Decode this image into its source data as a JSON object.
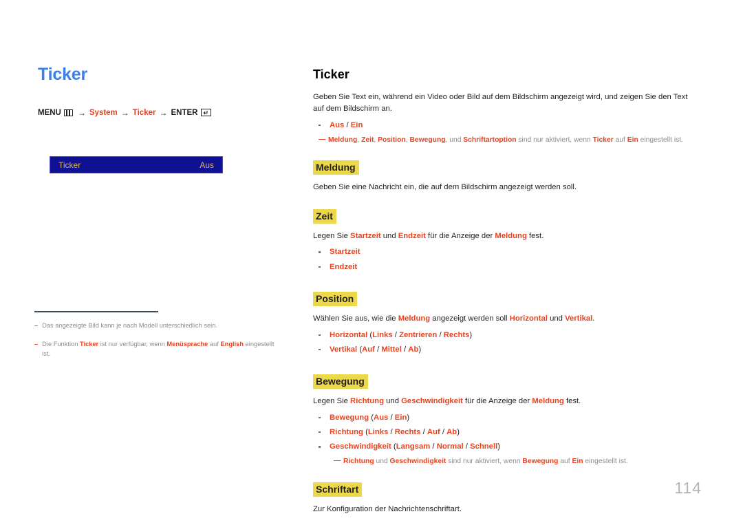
{
  "left": {
    "title": "Ticker",
    "menu_path": {
      "menu_label": "MENU",
      "menu_icon": "menu-grid-icon",
      "arrow": "→",
      "step1": "System",
      "step2": "Ticker",
      "enter_label": "ENTER",
      "enter_icon": "enter-key-icon",
      "enter_glyph": "↵"
    },
    "osd": {
      "label": "Ticker",
      "value": "Aus",
      "bg_color": "#101093",
      "text_color": "#e3b93c"
    },
    "footnotes": [
      {
        "dash": "–",
        "parts": [
          {
            "t": "Das angezeigte Bild kann je nach Modell unterschiedlich sein.",
            "b": false
          }
        ]
      },
      {
        "dash": "–",
        "parts": [
          {
            "t": "Die Funktion ",
            "b": false
          },
          {
            "t": "Ticker",
            "b": true
          },
          {
            "t": " ist nur verfügbar, wenn ",
            "b": false
          },
          {
            "t": "Menüsprache",
            "b": true
          },
          {
            "t": " auf ",
            "b": false
          },
          {
            "t": "English",
            "b": true
          },
          {
            "t": " eingestellt ist.",
            "b": false
          }
        ]
      }
    ]
  },
  "right": {
    "title": "Ticker",
    "intro": [
      {
        "t": "Geben Sie Text ein, während ein Video oder Bild auf dem Bildschirm angezeigt wird, und zeigen Sie den Text auf dem Bildschirm an.",
        "b": false
      }
    ],
    "intro_bullets": [
      [
        {
          "t": "Aus",
          "b": true
        },
        {
          "t": " / ",
          "b": false
        },
        {
          "t": "Ein",
          "b": true
        }
      ]
    ],
    "intro_note": {
      "dash": "—",
      "parts": [
        {
          "t": "Meldung",
          "b": true
        },
        {
          "t": ", ",
          "b": false
        },
        {
          "t": "Zeit",
          "b": true
        },
        {
          "t": ", ",
          "b": false
        },
        {
          "t": "Position",
          "b": true
        },
        {
          "t": ", ",
          "b": false
        },
        {
          "t": "Bewegung",
          "b": true
        },
        {
          "t": ", und ",
          "b": false
        },
        {
          "t": "Schriftartoption",
          "b": true
        },
        {
          "t": " sind nur aktiviert, wenn ",
          "b": false
        },
        {
          "t": "Ticker",
          "b": true
        },
        {
          "t": " auf ",
          "b": false
        },
        {
          "t": "Ein",
          "b": true
        },
        {
          "t": " eingestellt ist.",
          "b": false
        }
      ]
    },
    "sections": [
      {
        "heading": "Meldung",
        "paragraph": [
          {
            "t": "Geben Sie eine Nachricht ein, die auf dem Bildschirm angezeigt werden soll.",
            "b": false
          }
        ],
        "bullets": [],
        "note": null
      },
      {
        "heading": "Zeit",
        "paragraph": [
          {
            "t": "Legen Sie ",
            "b": false
          },
          {
            "t": "Startzeit",
            "b": true
          },
          {
            "t": " und ",
            "b": false
          },
          {
            "t": "Endzeit",
            "b": true
          },
          {
            "t": " für die Anzeige der ",
            "b": false
          },
          {
            "t": "Meldung",
            "b": true
          },
          {
            "t": " fest.",
            "b": false
          }
        ],
        "bullets": [
          [
            {
              "t": "Startzeit",
              "b": true
            }
          ],
          [
            {
              "t": "Endzeit",
              "b": true
            }
          ]
        ],
        "note": null
      },
      {
        "heading": "Position",
        "paragraph": [
          {
            "t": "Wählen Sie aus, wie die ",
            "b": false
          },
          {
            "t": "Meldung",
            "b": true
          },
          {
            "t": " angezeigt werden soll ",
            "b": false
          },
          {
            "t": "Horizontal",
            "b": true
          },
          {
            "t": " und ",
            "b": false
          },
          {
            "t": "Vertikal",
            "b": true
          },
          {
            "t": ".",
            "b": false
          }
        ],
        "bullets": [
          [
            {
              "t": "Horizontal",
              "b": true
            },
            {
              "t": " (",
              "b": false
            },
            {
              "t": "Links",
              "b": true
            },
            {
              "t": " / ",
              "b": false
            },
            {
              "t": "Zentrieren",
              "b": true
            },
            {
              "t": " / ",
              "b": false
            },
            {
              "t": "Rechts",
              "b": true
            },
            {
              "t": ")",
              "b": false
            }
          ],
          [
            {
              "t": "Vertikal",
              "b": true
            },
            {
              "t": " (",
              "b": false
            },
            {
              "t": "Auf",
              "b": true
            },
            {
              "t": " / ",
              "b": false
            },
            {
              "t": "Mittel",
              "b": true
            },
            {
              "t": " / ",
              "b": false
            },
            {
              "t": "Ab",
              "b": true
            },
            {
              "t": ")",
              "b": false
            }
          ]
        ],
        "note": null
      },
      {
        "heading": "Bewegung",
        "paragraph": [
          {
            "t": "Legen Sie ",
            "b": false
          },
          {
            "t": "Richtung",
            "b": true
          },
          {
            "t": " und ",
            "b": false
          },
          {
            "t": "Geschwindigkeit",
            "b": true
          },
          {
            "t": " für die Anzeige der ",
            "b": false
          },
          {
            "t": "Meldung",
            "b": true
          },
          {
            "t": " fest.",
            "b": false
          }
        ],
        "bullets": [
          [
            {
              "t": "Bewegung",
              "b": true
            },
            {
              "t": " (",
              "b": false
            },
            {
              "t": "Aus",
              "b": true
            },
            {
              "t": " / ",
              "b": false
            },
            {
              "t": "Ein",
              "b": true
            },
            {
              "t": ")",
              "b": false
            }
          ],
          [
            {
              "t": "Richtung",
              "b": true
            },
            {
              "t": " (",
              "b": false
            },
            {
              "t": "Links",
              "b": true
            },
            {
              "t": " / ",
              "b": false
            },
            {
              "t": "Rechts",
              "b": true
            },
            {
              "t": " / ",
              "b": false
            },
            {
              "t": "Auf",
              "b": true
            },
            {
              "t": " / ",
              "b": false
            },
            {
              "t": "Ab",
              "b": true
            },
            {
              "t": ")",
              "b": false
            }
          ],
          [
            {
              "t": "Geschwindigkeit",
              "b": true
            },
            {
              "t": " (",
              "b": false
            },
            {
              "t": "Langsam",
              "b": true
            },
            {
              "t": " / ",
              "b": false
            },
            {
              "t": "Normal",
              "b": true
            },
            {
              "t": " / ",
              "b": false
            },
            {
              "t": "Schnell",
              "b": true
            },
            {
              "t": ")",
              "b": false
            }
          ]
        ],
        "note": {
          "dash": "—",
          "parts": [
            {
              "t": "Richtung",
              "b": true
            },
            {
              "t": " und ",
              "b": false
            },
            {
              "t": "Geschwindigkeit",
              "b": true
            },
            {
              "t": " sind nur aktiviert, wenn ",
              "b": false
            },
            {
              "t": "Bewegung",
              "b": true
            },
            {
              "t": " auf ",
              "b": false
            },
            {
              "t": "Ein",
              "b": true
            },
            {
              "t": " eingestellt ist.",
              "b": false
            }
          ]
        }
      },
      {
        "heading": "Schriftart",
        "paragraph": [
          {
            "t": "Zur Konfiguration der Nachrichtenschriftart.",
            "b": false
          }
        ],
        "bullets": [],
        "note": null
      }
    ]
  },
  "page_number": "114",
  "colors": {
    "accent_blue": "#3d7fe8",
    "accent_red": "#e8421f",
    "highlight_yellow": "#ecd94a",
    "osd_blue": "#101093",
    "osd_gold": "#e3b93c",
    "muted_gray": "#8c8c8c"
  }
}
